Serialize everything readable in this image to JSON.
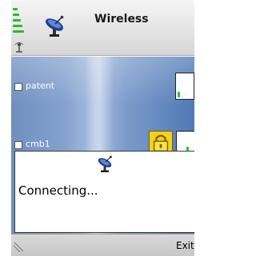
{
  "window": {
    "title": "Wireless"
  },
  "icons": {
    "signal": "signal-strength-icon",
    "antenna": "antenna-icon",
    "app": "satellite-dish-icon",
    "dialog": "satellite-dish-icon",
    "lock": "lock-icon"
  },
  "networks": [
    {
      "name": "patent",
      "secured": false,
      "signal_level": 0.2
    },
    {
      "name": "cmb1",
      "secured": true,
      "signal_level": 0.2
    }
  ],
  "dialog": {
    "message": "Connecting..."
  },
  "softkeys": {
    "right": "Exit"
  },
  "colors": {
    "signal_green": "#2ec72e",
    "lock_yellow": "#f2d21a"
  }
}
